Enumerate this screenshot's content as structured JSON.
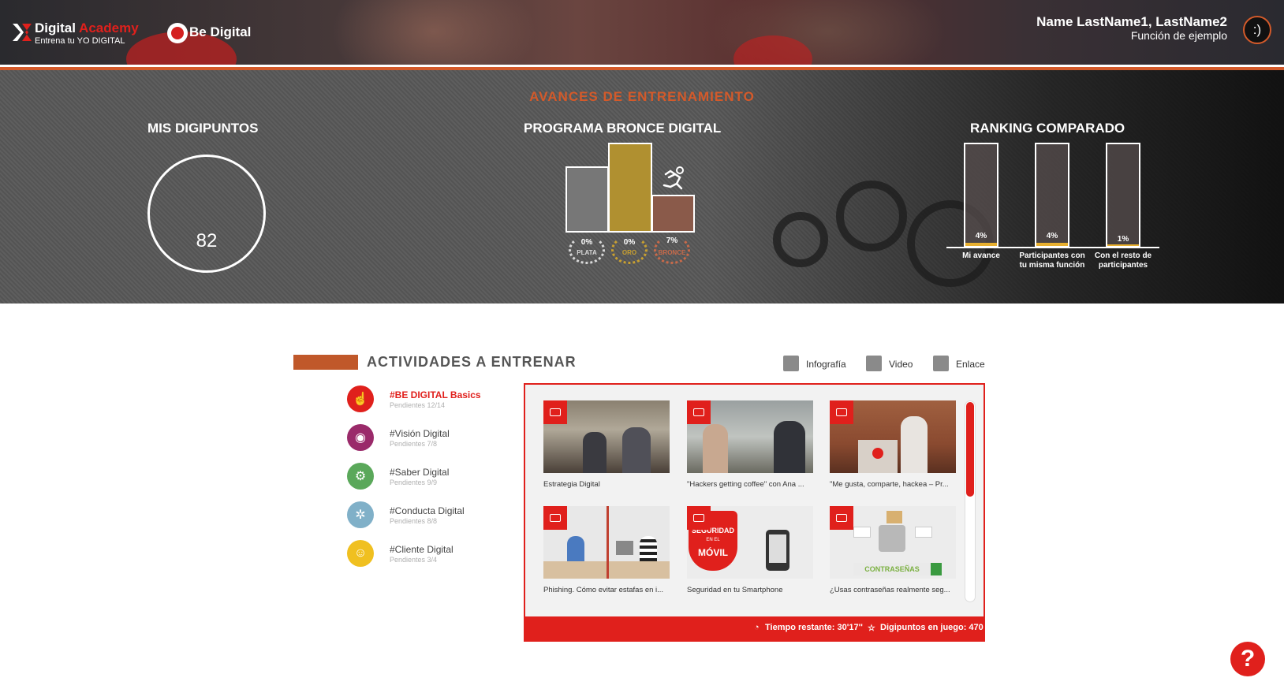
{
  "header": {
    "logo_title_1": "Digital",
    "logo_title_2": "Academy",
    "logo_subtitle": "Entrena tu YO DIGITAL",
    "brand_label": "Be Digital",
    "user_name": "Name LastName1, LastName2",
    "user_role": "Función de ejemplo",
    "avatar_text": ":)"
  },
  "progress": {
    "title": "AVANCES DE ENTRENAMIENTO",
    "digipoints": {
      "title": "MIS DIGIPUNTOS",
      "value": "82"
    },
    "program": {
      "title": "PROGRAMA BRONCE DIGITAL",
      "levels": [
        {
          "pct": "0%",
          "label": "PLATA",
          "color": "#d8d8d8"
        },
        {
          "pct": "0%",
          "label": "ORO",
          "color": "#c9a030"
        },
        {
          "pct": "7%",
          "label": "BRONCE",
          "color": "#c86a4a"
        }
      ]
    },
    "ranking": {
      "title": "RANKING COMPARADO",
      "bars": [
        {
          "pct": "4%",
          "label_1": "Mi avance",
          "label_2": "",
          "value": 4
        },
        {
          "pct": "4%",
          "label_1": "Participantes con",
          "label_2": "tu misma función",
          "value": 4
        },
        {
          "pct": "1%",
          "label_1": "Con el resto de",
          "label_2": "participantes",
          "value": 1
        }
      ]
    }
  },
  "activities": {
    "title": "ACTIVIDADES A ENTRENAR",
    "legend": [
      "Infografía",
      "Video",
      "Enlace"
    ],
    "categories": [
      {
        "name": "#BE DIGITAL Basics",
        "pending": "Pendientes 12/14",
        "color": "#e0201c",
        "icon": "hand-tap-icon"
      },
      {
        "name": "#Visión Digital",
        "pending": "Pendientes 7/8",
        "color": "#9a2a6a",
        "icon": "eye-icon"
      },
      {
        "name": "#Saber Digital",
        "pending": "Pendientes 9/9",
        "color": "#5aa85a",
        "icon": "brain-icon"
      },
      {
        "name": "#Conducta Digital",
        "pending": "Pendientes 8/8",
        "color": "#80b0c8",
        "icon": "network-icon"
      },
      {
        "name": "#Cliente Digital",
        "pending": "Pendientes 3/4",
        "color": "#f0c020",
        "icon": "users-icon"
      }
    ],
    "cards": [
      {
        "title": "Estrategia Digital"
      },
      {
        "title": "\"Hackers getting coffee\" con Ana ..."
      },
      {
        "title": "\"Me gusta, comparte, hackea – Pr..."
      },
      {
        "title": "Phishing. Cómo evitar estafas en i..."
      },
      {
        "title": "Seguridad en tu Smartphone"
      },
      {
        "title": "¿Usas contraseñas realmente seg..."
      }
    ],
    "thumb_texts": {
      "seguridad": "SEGURIDAD",
      "en_el": "EN EL",
      "movil": "MÓVIL",
      "contrasenas": "CONTRASEÑAS"
    },
    "footer": {
      "time": "Tiempo restante: 30'17''",
      "points": "Digipuntos en juego: 470"
    }
  },
  "help": {
    "label": "?"
  }
}
